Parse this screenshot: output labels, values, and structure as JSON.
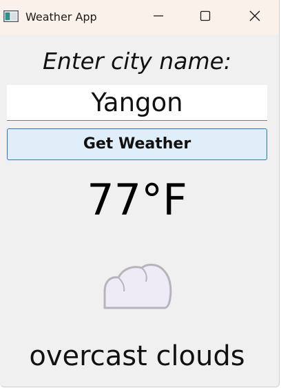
{
  "window": {
    "title": "Weather App",
    "icon": "app-window-icon",
    "controls": {
      "minimize": "minimize-icon",
      "maximize": "maximize-icon",
      "close": "close-icon"
    }
  },
  "form": {
    "prompt": "Enter city name:",
    "city_value": "Yangon",
    "button_label": "Get Weather"
  },
  "result": {
    "temperature": "77°F",
    "condition_icon": "cloud-icon",
    "description": "overcast clouds"
  },
  "colors": {
    "titlebar": "#faf1ea",
    "background": "#f0f0f0",
    "button_fill": "#e0eef9",
    "button_border": "#2a76c6",
    "cloud_fill": "#eeeaf6",
    "cloud_outline": "#b7b3bd"
  }
}
